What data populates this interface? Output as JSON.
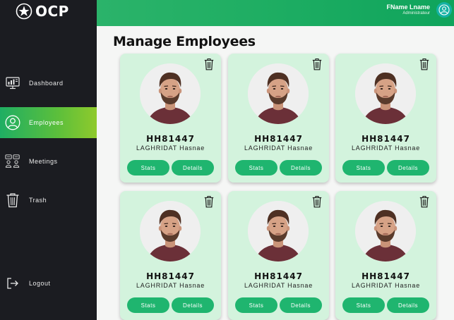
{
  "brand": {
    "name": "OCP"
  },
  "header": {
    "user_name": "FName Lname",
    "user_role": "Administrateur"
  },
  "sidebar": {
    "items": [
      {
        "label": "Dashboard",
        "icon": "dashboard-icon"
      },
      {
        "label": "Employees",
        "icon": "user-circle-icon",
        "active": true
      },
      {
        "label": "Meetings",
        "icon": "meeting-icon"
      },
      {
        "label": "Trash",
        "icon": "trash-icon"
      },
      {
        "label": "Logout",
        "icon": "logout-icon"
      }
    ]
  },
  "main": {
    "title": "Manage Employees",
    "cards": [
      {
        "id": "HH81447",
        "name": "LAGHRIDAT Hasnae",
        "stats_label": "Stats",
        "details_label": "Details"
      },
      {
        "id": "HH81447",
        "name": "LAGHRIDAT Hasnae",
        "stats_label": "Stats",
        "details_label": "Details"
      },
      {
        "id": "HH81447",
        "name": "LAGHRIDAT Hasnae",
        "stats_label": "Stats",
        "details_label": "Details"
      },
      {
        "id": "HH81447",
        "name": "LAGHRIDAT Hasnae",
        "stats_label": "Stats",
        "details_label": "Details"
      },
      {
        "id": "HH81447",
        "name": "LAGHRIDAT Hasnae",
        "stats_label": "Stats",
        "details_label": "Details"
      },
      {
        "id": "HH81447",
        "name": "LAGHRIDAT Hasnae",
        "stats_label": "Stats",
        "details_label": "Details"
      }
    ]
  },
  "colors": {
    "sidebar_bg": "#1b1c21",
    "accent_green": "#1fae63",
    "card_bg": "#d3f3dd",
    "button_green": "#1fb56f",
    "avatar_teal": "#15b2a4"
  }
}
